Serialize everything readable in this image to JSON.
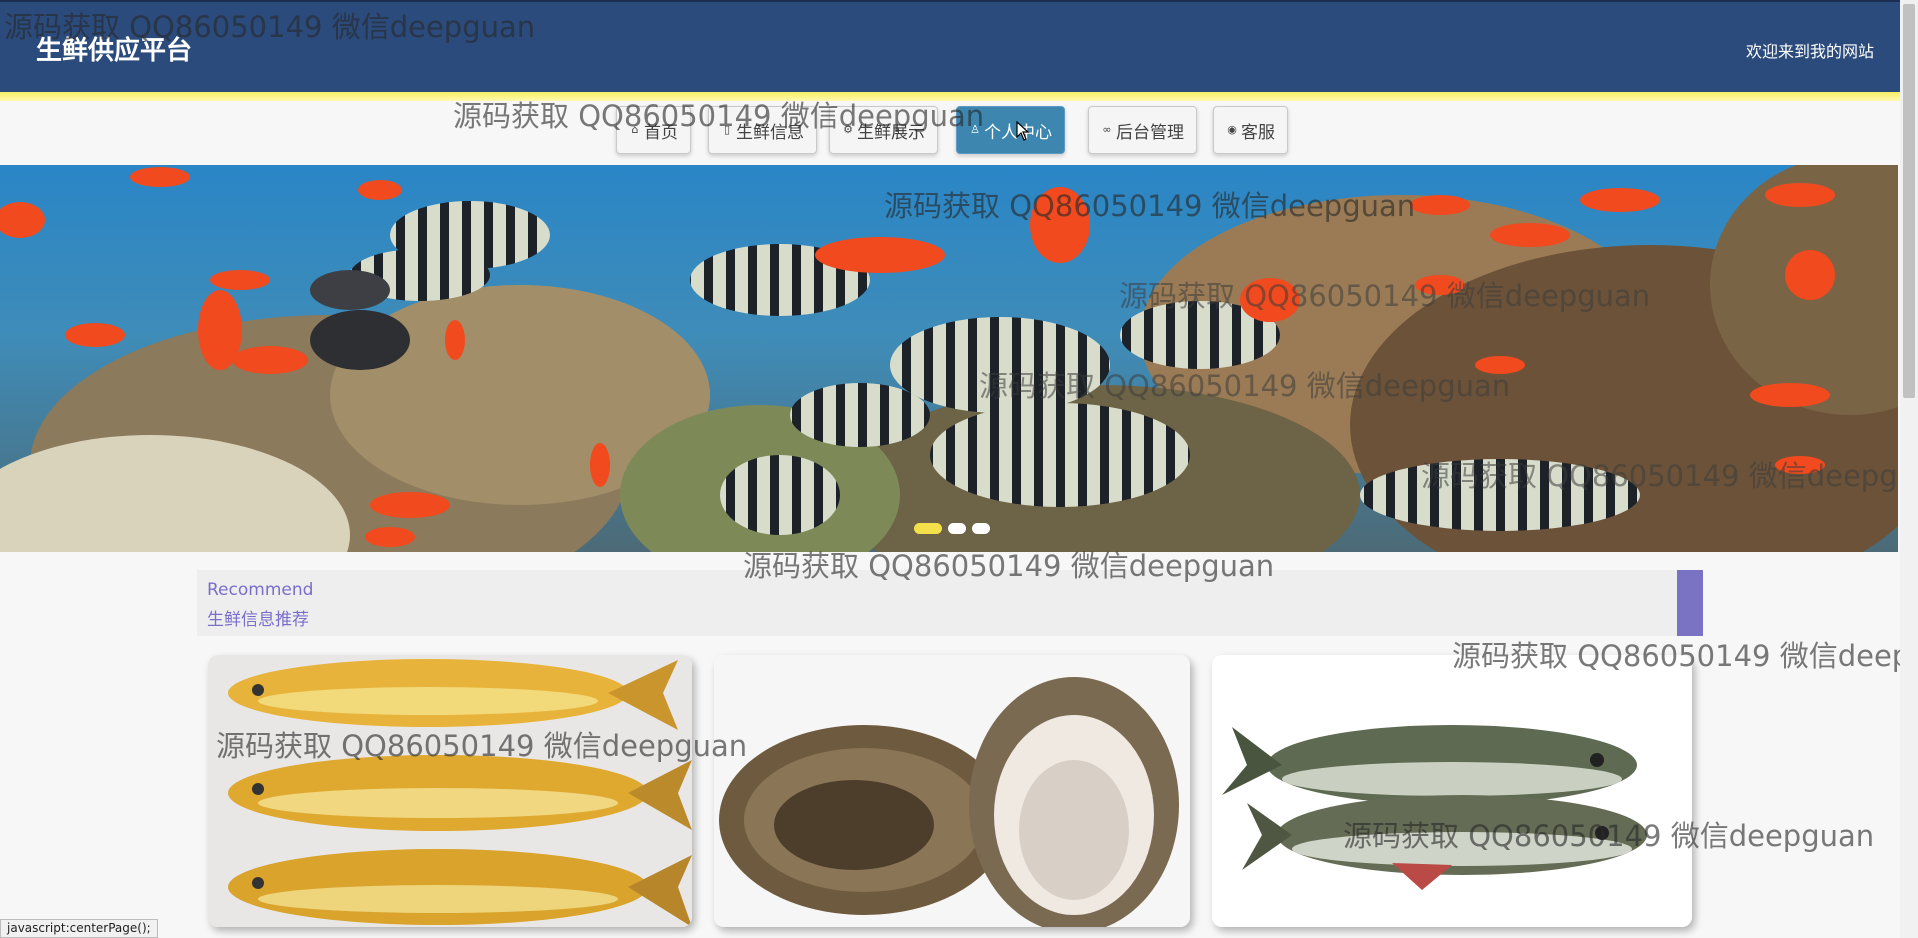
{
  "header": {
    "site_title": "生鲜供应平台",
    "welcome_text": "欢迎来到我的网站",
    "stripe_color": "#f7ee63",
    "background_color": "#2b4b7c"
  },
  "nav": {
    "items": [
      {
        "label": "首页",
        "icon": "home-icon",
        "active": false
      },
      {
        "label": "生鲜信息",
        "icon": "list-icon",
        "active": false
      },
      {
        "label": "生鲜展示",
        "icon": "gear-icon",
        "active": false
      },
      {
        "label": "个人中心",
        "icon": "user-icon",
        "active": true
      },
      {
        "label": "后台管理",
        "icon": "link-icon",
        "active": false
      },
      {
        "label": "客服",
        "icon": "chat-icon",
        "active": false
      }
    ],
    "active_color": "#3c86b0"
  },
  "banner": {
    "slide_count": 3,
    "active_slide": 1
  },
  "recommend": {
    "title_en": "Recommend",
    "title_cn": "生鲜信息推荐",
    "accent_color": "#7a73c4"
  },
  "products": [
    {
      "name": "yellow-croaker-image"
    },
    {
      "name": "oyster-image"
    },
    {
      "name": "carp-image"
    }
  ],
  "watermark": {
    "text": "源码获取 QQ86050149 微信deepguan"
  },
  "status_bar": {
    "text": "javascript:centerPage();"
  }
}
